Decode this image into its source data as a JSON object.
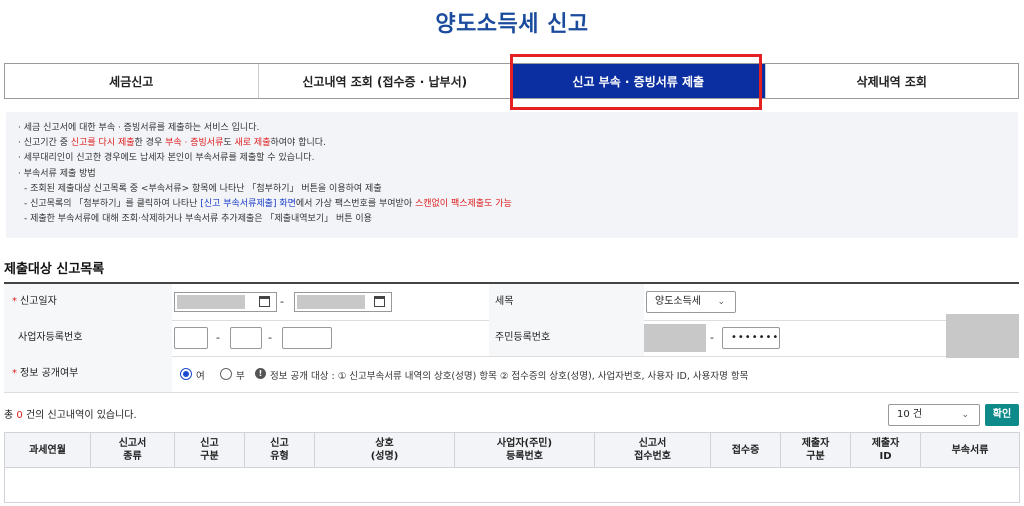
{
  "page_title": "양도소득세 신고",
  "tabs": [
    {
      "label": "세금신고"
    },
    {
      "label": "신고내역 조회 (접수증 · 납부서)"
    },
    {
      "label": "신고 부속 · 증빙서류 제출"
    },
    {
      "label": "삭제내역 조회"
    }
  ],
  "notice": {
    "l1": "· 세금 신고서에 대한 부속 · 증빙서류를 제출하는 서비스 입니다.",
    "l2a": "· 신고기간 중 ",
    "l2b": "신고를 다시 제출",
    "l2c": "한 경우 ",
    "l2d": "부속 · 증빙서류",
    "l2e": "도 ",
    "l2f": "새로 제출",
    "l2g": "하여야 합니다.",
    "l3": "· 세무대리인이 신고한 경우에도 납세자 본인이 부속서류를 제출할 수 있습니다.",
    "l4": "· 부속서류 제출 방법",
    "l5": "- 조회된 제출대상 신고목록 중 <부속서류> 항목에 나타난 「첨부하기」 버튼을 이용하여 제출",
    "l6a": "- 신고목록의 「첨부하기」를 클릭하여 나타난 ",
    "l6b": "[신고 부속서류제출] 화면",
    "l6c": "에서 가상 팩스번호를 부여받아 ",
    "l6d": "스캔없이 팩스제출도 가능",
    "l7": "- 제출한 부속서류에 대해 조회·삭제하거나 부속서류 추가제출은 「제출내역보기」 버튼 이용"
  },
  "section_title": "제출대상 신고목록",
  "form": {
    "report_date_label": "신고일자",
    "tax_item_label": "세목",
    "tax_item_value": "양도소득세",
    "biz_no_label": "사업자등록번호",
    "resident_no_label": "주민등록번호",
    "resident_no_masked": "•••••••",
    "disclose_label": "정보 공개여부",
    "opt_yes": "여",
    "opt_no": "부",
    "disclose_note": "정보 공개 대상 : ① 신고부속서류 내역의 상호(성명) 항목 ② 접수증의 상호(성명), 사업자번호, 사용자 ID, 사용자명 항목",
    "dash": "-",
    "required_mark": "*"
  },
  "list": {
    "count_prefix": "총 ",
    "count": "0",
    "count_suffix": " 건의 신고내역이 있습니다.",
    "per_page": "10 건",
    "confirm_label": "확인"
  },
  "table_headers": [
    [
      "과세연월"
    ],
    [
      "신고서",
      "종류"
    ],
    [
      "신고",
      "구분"
    ],
    [
      "신고",
      "유형"
    ],
    [
      "상호",
      "(성명)"
    ],
    [
      "사업자(주민)",
      "등록번호"
    ],
    [
      "신고서",
      "접수번호"
    ],
    [
      "접수증"
    ],
    [
      "제출자",
      "구분"
    ],
    [
      "제출자",
      "ID"
    ],
    [
      "부속서류"
    ]
  ],
  "colors": {
    "title": "#1a4b9c",
    "active_tab": "#0b2fa0",
    "highlight": "#e52020",
    "confirm": "#0e8a8a"
  }
}
